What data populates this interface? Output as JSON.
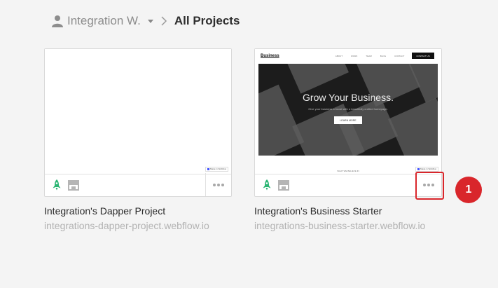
{
  "breadcrumb": {
    "workspace": "Integration W.",
    "current": "All Projects"
  },
  "projects": [
    {
      "name": "Integration's Dapper Project",
      "url": "integrations-dapper-project.webflow.io",
      "badge": "Made in Webflow"
    },
    {
      "name": "Integration's Business Starter",
      "url": "integrations-business-starter.webflow.io",
      "badge": "Made in Webflow",
      "preview": {
        "logo": "Business",
        "nav_links": [
          "ABOUT",
          "WORK",
          "TEAM",
          "BLOG",
          "CONTACT"
        ],
        "cta": "CONTACT US",
        "hero_title": "Grow Your Business.",
        "hero_subtitle": "Give your business a boost with a beautifully crafted homepage.",
        "hero_button": "LEARN MORE",
        "section_label": "WHAT WE BELIEVE IN"
      }
    }
  ],
  "step_marker": "1",
  "colors": {
    "accent_rocket": "#2bb673",
    "highlight": "#d9262b",
    "text_muted": "#b2b2b2"
  },
  "icons": {
    "user": "user-icon",
    "caret": "chevron-down-icon",
    "separator": "chevron-right-icon",
    "publish": "rocket-icon",
    "ecommerce": "store-icon",
    "more": "more-icon"
  }
}
